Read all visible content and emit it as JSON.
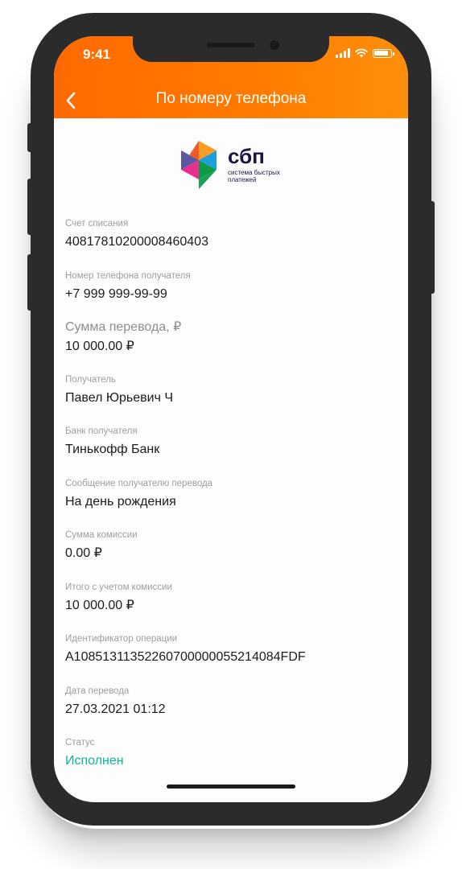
{
  "status_bar": {
    "time": "9:41"
  },
  "header": {
    "title": "По номеру телефона",
    "back_icon": "chevron-left-icon",
    "gradient_start": "#ff6a00",
    "gradient_end": "#ff8f0a"
  },
  "logo": {
    "word": "сбп",
    "subtitle_line1": "система быстрых",
    "subtitle_line2": "платежей"
  },
  "fields": [
    {
      "label": "Счет списания",
      "value": "40817810200008460403"
    },
    {
      "label": "Номер телефона получателя",
      "value": "+7 999 999-99-99"
    },
    {
      "label": "Сумма перевода, ₽",
      "value": "10 000.00 ₽"
    },
    {
      "label": "Получатель",
      "value": "Павел Юрьевич Ч"
    },
    {
      "label": "Банк получателя",
      "value": "Тинькофф Банк"
    },
    {
      "label": "Сообщение получателю перевода",
      "value": "На день рождения"
    },
    {
      "label": "Сумма комиссии",
      "value": "0.00 ₽"
    },
    {
      "label": "Итого с учетом комиссии",
      "value": "10 000.00 ₽"
    },
    {
      "label": "Идентификатор операции",
      "value": "A10851311352260700000055214084FDF"
    },
    {
      "label": "Дата перевода",
      "value": "27.03.2021 01:12"
    },
    {
      "label": "Статус",
      "value": "Исполнен"
    }
  ],
  "colors": {
    "status_success": "#12b39a",
    "label": "#9e9e9e",
    "value": "#1b1b1b"
  }
}
